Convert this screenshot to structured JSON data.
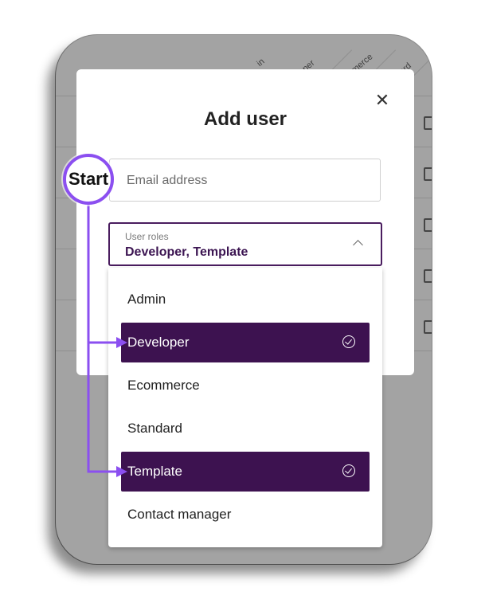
{
  "background_table": {
    "column_headers": [
      "in",
      "eloper",
      "mmerce",
      "dard"
    ]
  },
  "modal": {
    "title": "Add user",
    "close_icon": "close-icon",
    "email": {
      "placeholder": "Email address",
      "value": ""
    },
    "roles": {
      "label": "User roles",
      "value": "Developer, Template",
      "icon": "chevron-up-icon"
    },
    "menu": {
      "options": [
        {
          "label": "Admin",
          "selected": false
        },
        {
          "label": "Developer",
          "selected": true
        },
        {
          "label": "Ecommerce",
          "selected": false
        },
        {
          "label": "Standard",
          "selected": false
        },
        {
          "label": "Template",
          "selected": true
        },
        {
          "label": "Contact manager",
          "selected": false
        }
      ]
    }
  },
  "annotation": {
    "start_label": "Start",
    "accent_color": "#8b4ff0"
  },
  "colors": {
    "brand_purple": "#3d1250",
    "frame_gray": "#a3a3a3"
  }
}
